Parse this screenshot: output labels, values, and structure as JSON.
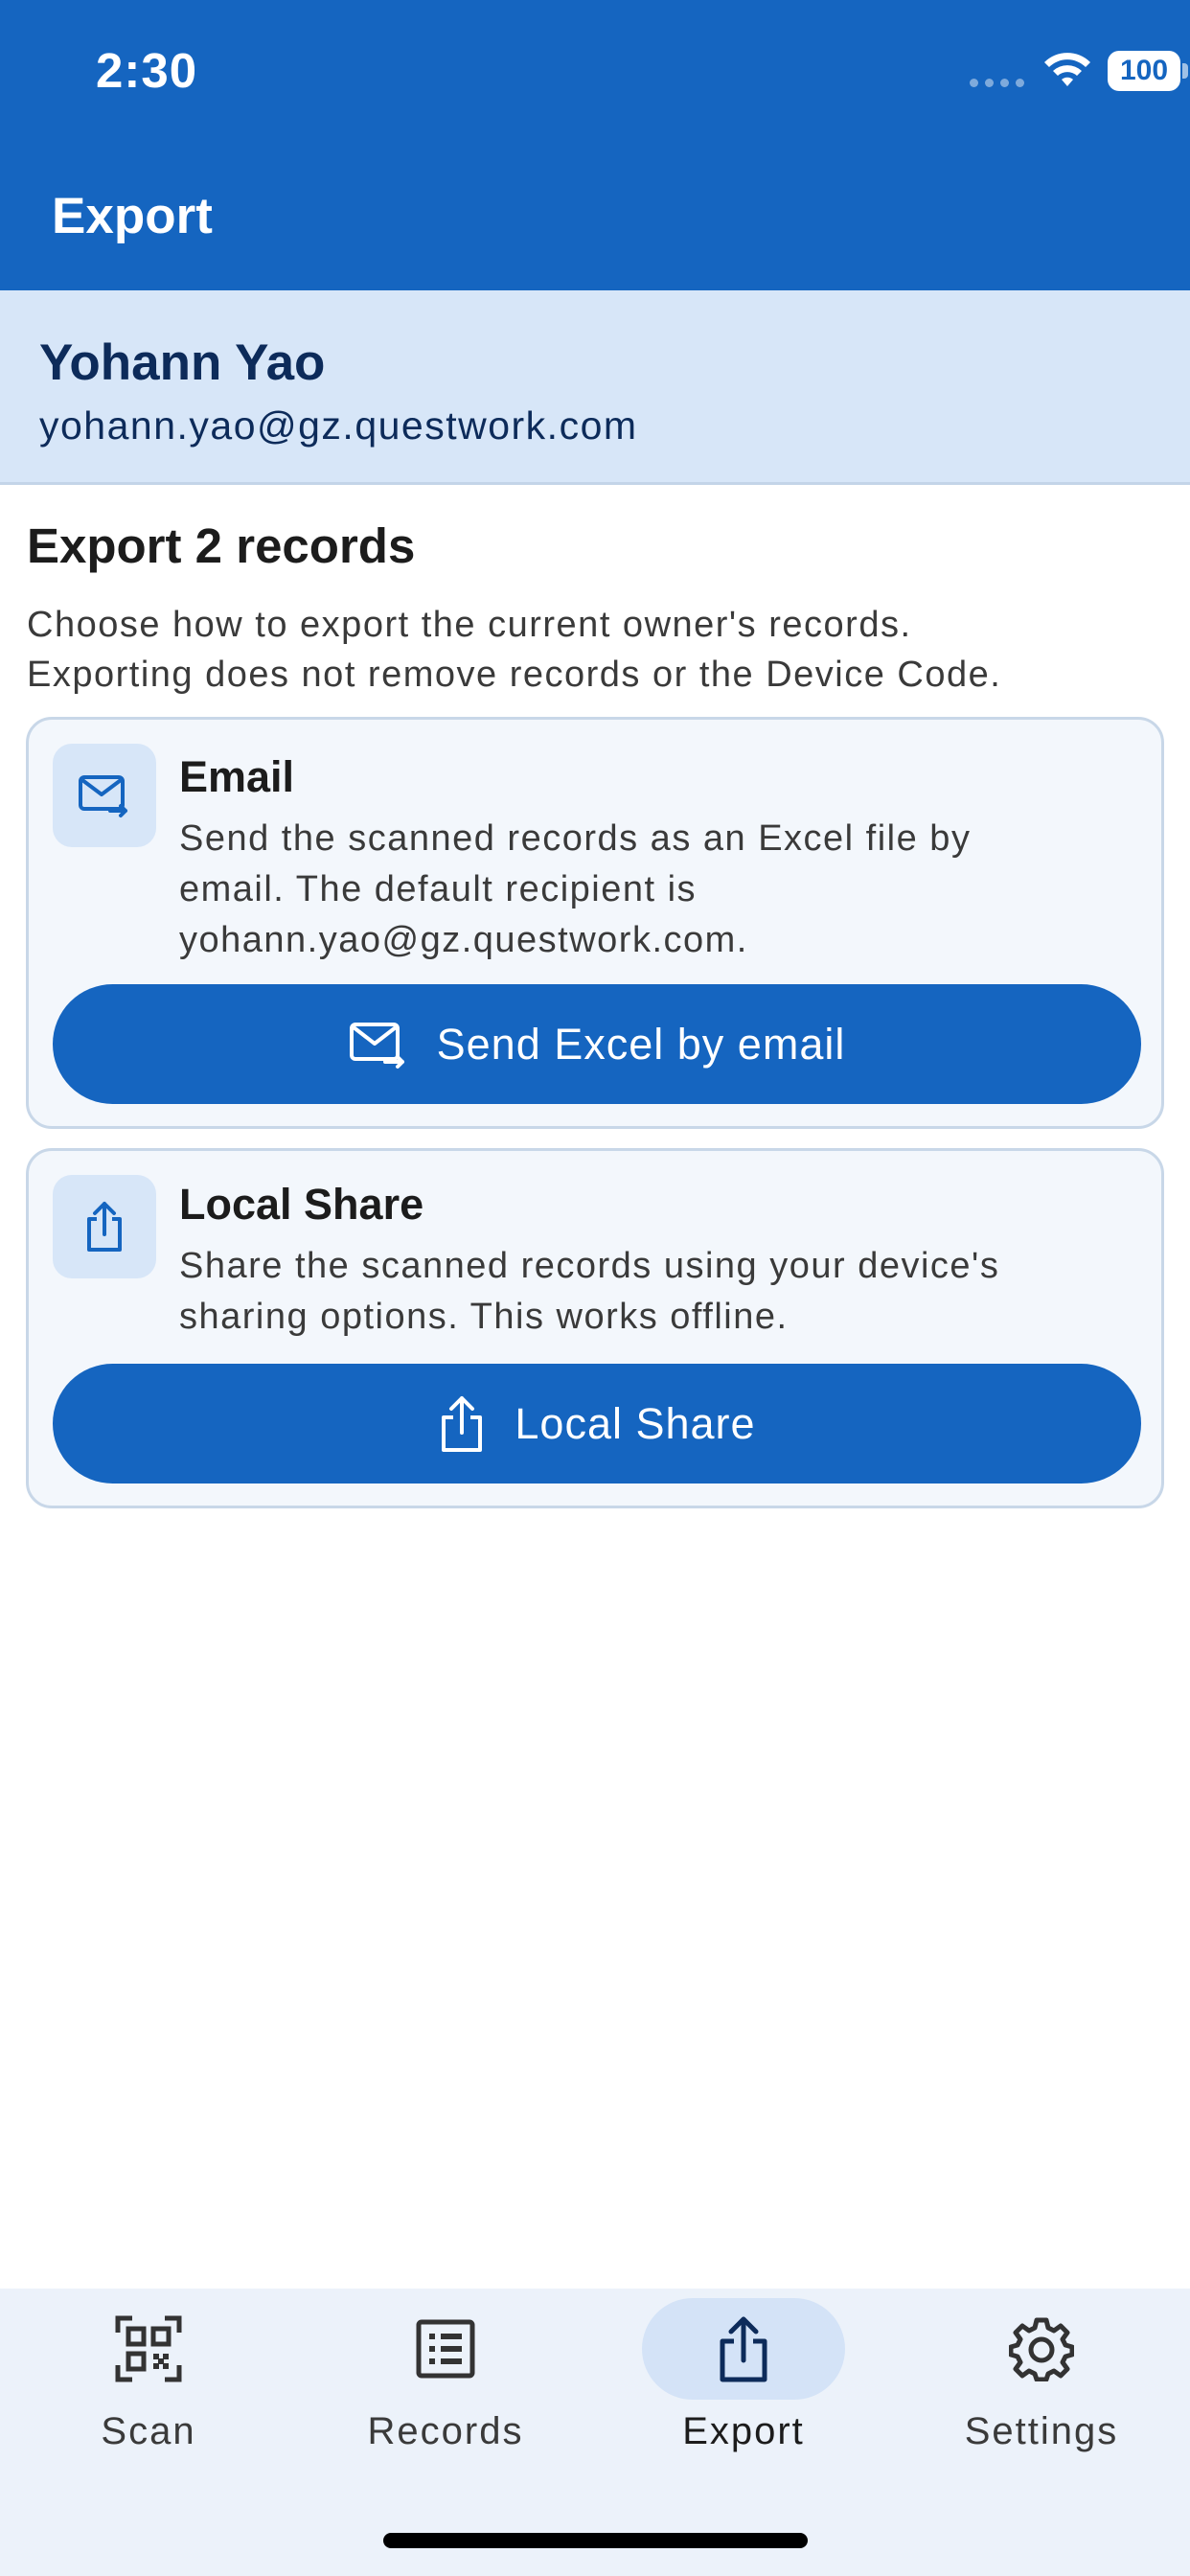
{
  "status_bar": {
    "time": "2:30",
    "battery": "100"
  },
  "app_bar": {
    "title": "Export"
  },
  "owner": {
    "name": "Yohann Yao",
    "email": "yohann.yao@gz.questwork.com"
  },
  "export": {
    "heading": "Export 2 records",
    "description_line1": "Choose how to export the current owner's records.",
    "description_line2": "Exporting does not remove records or the Device Code."
  },
  "email_card": {
    "icon": "mail-forward-icon",
    "title": "Email",
    "text_line1": "Send the scanned records as an Excel file by",
    "text_line2": "email. The default recipient is",
    "text_line3": "yohann.yao@gz.questwork.com.",
    "button_label": "Send Excel by email"
  },
  "share_card": {
    "icon": "share-icon",
    "title": "Local Share",
    "text_line1": "Share the scanned records using your device's",
    "text_line2": "sharing options. This works offline.",
    "button_label": "Local Share"
  },
  "bottom_nav": {
    "items": [
      {
        "label": "Scan",
        "icon": "qr-code-icon",
        "active": false
      },
      {
        "label": "Records",
        "icon": "list-icon",
        "active": false
      },
      {
        "label": "Export",
        "icon": "share-icon",
        "active": true
      },
      {
        "label": "Settings",
        "icon": "gear-icon",
        "active": false
      }
    ]
  },
  "colors": {
    "primary": "#1565c0",
    "owner_banner": "#d7e6f8",
    "card_background": "#f3f7fc",
    "nav_background": "#ecf2fa"
  }
}
